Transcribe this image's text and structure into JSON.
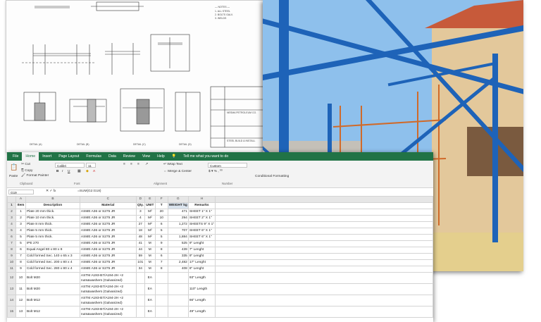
{
  "drawing": {
    "title_block": [
      "NESMA PETROLEUM CO.",
      "STEEL BUILD & INSTALL"
    ],
    "details": [
      "DETAIL (A)",
      "DETAIL (B)",
      "DETAIL (C)",
      "DETAIL (D)"
    ]
  },
  "excel": {
    "tabs": [
      "File",
      "Home",
      "Insert",
      "Page Layout",
      "Formulas",
      "Data",
      "Review",
      "View",
      "Help",
      "Tell me what you want to do"
    ],
    "clipboard": {
      "paste": "Paste",
      "cut": "Cut",
      "copy": "Copy",
      "format_painter": "Format Painter",
      "group": "Clipboard"
    },
    "font": {
      "name": "Calibri",
      "size": "11",
      "group": "Font"
    },
    "alignment": {
      "wrap": "Wrap Text",
      "merge": "Merge & Center",
      "group": "Alignment"
    },
    "number": {
      "format": "Custom",
      "group": "Number"
    },
    "cond": "Conditional Formatting",
    "name_box": "G19",
    "formula": "=SUM(G2:G18)",
    "columns": [
      "A",
      "B",
      "C",
      "D",
      "E",
      "F",
      "G",
      "H"
    ],
    "headers": [
      "Item",
      "Description",
      "Material",
      "Qty.",
      "UNIT",
      "T",
      "WEIGHT kg",
      "Remarks"
    ],
    "rows": [
      [
        "2",
        "1",
        "Plate 20 mm thick.",
        "ASME A36 or S275 JR",
        "3",
        "M²",
        "20",
        "471",
        "SHEET 1\" X 1\""
      ],
      [
        "3",
        "2",
        "Plate 10 mm thick.",
        "ASME A36 or S275 JR",
        "4",
        "M²",
        "10",
        "294",
        "SHEET 2\" X 1\""
      ],
      [
        "4",
        "3",
        "Plate 8 mm thick.",
        "ASME A36 or S275 JR",
        "27",
        "M²",
        "6",
        "1,272",
        "SHEETS 9\" X 1\""
      ],
      [
        "5",
        "4",
        "Plate 5 mm thick.",
        "ASME A36 or S275 JR",
        "18",
        "M²",
        "5",
        "707",
        "SHEET 6\" X 1\""
      ],
      [
        "6",
        "5",
        "Plate 5 mm thick.",
        "ASME A36 or S275 JR",
        "48",
        "M²",
        "5",
        "1,884",
        "SHEET 6\" X 1\""
      ],
      [
        "7",
        "5",
        "IPE 270",
        "ASME A36 or S275 JR",
        "41",
        "M",
        "9",
        "525",
        "9\" Lenght"
      ],
      [
        "8",
        "6",
        "Equal Angel 80 x 80 x 8",
        "ASME A36 or S275 JR",
        "44",
        "M",
        "8",
        "439",
        "7\" Lenght"
      ],
      [
        "9",
        "7",
        "Cold formed Sec. 140 x 65 x 3",
        "ASME A36 or S275 JR",
        "59",
        "M",
        "6",
        "335",
        "9\" Lenght"
      ],
      [
        "10",
        "8",
        "Cold formed Sec. 200 x 80 x 4",
        "ASME A36 or S275 JR",
        "101",
        "M",
        "7",
        "2,482",
        "17\" Lenght"
      ],
      [
        "11",
        "9",
        "Cold formed Sec. 280 x 80 x 4",
        "ASME A36 or S275 JR",
        "34",
        "M",
        "8",
        "408",
        "8\" Lenght"
      ]
    ],
    "tall_rows": [
      [
        "12",
        "10",
        "Bolt M20",
        "ASTM A193-B7/A194-2H +2 nuts&washers (Galvanized)",
        "",
        "EA",
        "",
        "",
        "93\" Length"
      ],
      [
        "13",
        "11",
        "Bolt M20",
        "ASTM A193-B7/A194-2H +2 nuts&washers (Galvanized)",
        "",
        "EA",
        "",
        "",
        "110\" Length"
      ],
      [
        "14",
        "12",
        "Bolt M12",
        "ASTM A193-B7/A194-2H +2 nuts&washers (Galvanized)",
        "",
        "EA",
        "",
        "",
        "66\" Length"
      ],
      [
        "15",
        "13",
        "Bolt M12",
        "ASTM A193-B7/A194-2H +2 nuts&washers (Galvanized)",
        "",
        "EA",
        "",
        "",
        "49\" Length"
      ]
    ]
  },
  "colors": {
    "excel_green": "#217346",
    "steel_blue": "#1e63b8",
    "sky": "#8ec0ec"
  }
}
